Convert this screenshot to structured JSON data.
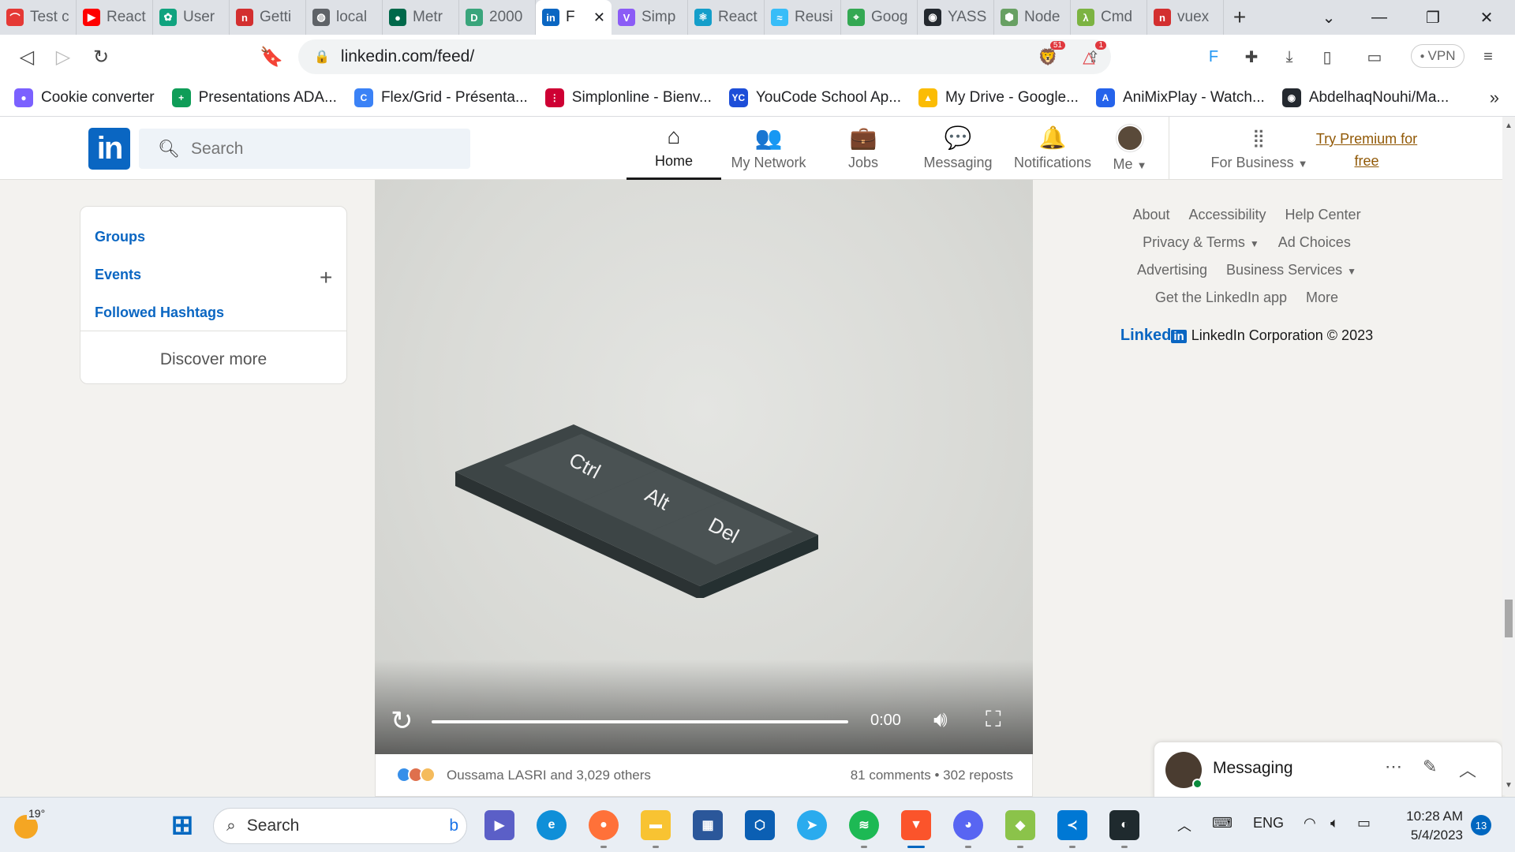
{
  "browser": {
    "tabs": [
      {
        "title": "Test c",
        "color": "#e53935",
        "glyph": "⌒"
      },
      {
        "title": "React",
        "color": "#ff0000",
        "glyph": "▶"
      },
      {
        "title": "User",
        "color": "#10a37f",
        "glyph": "✿"
      },
      {
        "title": "Getti",
        "color": "#d32f2f",
        "glyph": "n"
      },
      {
        "title": "local",
        "color": "#5f6368",
        "glyph": "◍"
      },
      {
        "title": "Metr",
        "color": "#00684a",
        "glyph": "●"
      },
      {
        "title": "2000",
        "color": "#3aa57c",
        "glyph": "D"
      },
      {
        "title": "F",
        "color": "#0a66c2",
        "glyph": "in"
      },
      {
        "title": "Simp",
        "color": "#8b5cf6",
        "glyph": "V"
      },
      {
        "title": "React",
        "color": "#149eca",
        "glyph": "⚛"
      },
      {
        "title": "Reusi",
        "color": "#38bdf8",
        "glyph": "≈"
      },
      {
        "title": "Goog",
        "color": "#34a853",
        "glyph": "⌖"
      },
      {
        "title": "YASS",
        "color": "#24292f",
        "glyph": "◉"
      },
      {
        "title": "Node",
        "color": "#68a063",
        "glyph": "⬢"
      },
      {
        "title": "Cmd",
        "color": "#7cb342",
        "glyph": "λ"
      },
      {
        "title": "vuex",
        "color": "#d32f2f",
        "glyph": "n"
      }
    ],
    "url": "linkedin.com/feed/",
    "brave_badge": "51",
    "alert_badge": "1",
    "vpn_label": "VPN",
    "bookmarks": [
      {
        "label": "Cookie converter",
        "color": "#7b61ff",
        "glyph": "●"
      },
      {
        "label": "Presentations ADA...",
        "color": "#0f9d58",
        "glyph": "+"
      },
      {
        "label": "Flex/Grid - Présenta...",
        "color": "#3b82f6",
        "glyph": "C"
      },
      {
        "label": "Simplonline - Bienv...",
        "color": "#ce0033",
        "glyph": "⋮"
      },
      {
        "label": "YouCode School Ap...",
        "color": "#1d4ed8",
        "glyph": "YC"
      },
      {
        "label": "My Drive - Google...",
        "color": "#fbbc04",
        "glyph": "▲"
      },
      {
        "label": "AniMixPlay - Watch...",
        "color": "#2563eb",
        "glyph": "A"
      },
      {
        "label": "AbdelhaqNouhi/Ma...",
        "color": "#24292f",
        "glyph": "◉"
      }
    ]
  },
  "linkedin": {
    "logo": "in",
    "search_placeholder": "Search",
    "nav": [
      {
        "label": "Home",
        "icon": "home-icon",
        "glyph": "⌂"
      },
      {
        "label": "My Network",
        "icon": "network-icon",
        "glyph": "👥"
      },
      {
        "label": "Jobs",
        "icon": "briefcase-icon",
        "glyph": "💼"
      },
      {
        "label": "Messaging",
        "icon": "chat-icon",
        "glyph": "💬"
      },
      {
        "label": "Notifications",
        "icon": "bell-icon",
        "glyph": "🔔"
      }
    ],
    "me_label": "Me",
    "for_business_label": "For Business",
    "premium_line1": "Try Premium for",
    "premium_line2": "free",
    "sidebar": {
      "groups": "Groups",
      "events": "Events",
      "hashtags": "Followed Hashtags",
      "discover": "Discover more"
    },
    "video": {
      "key_labels": [
        "Ctrl",
        "Alt",
        "Del"
      ],
      "time": "0:00",
      "progress": 0
    },
    "post_stats": {
      "reactions": "Oussama LASRI and 3,029 others",
      "comments_reposts": "81 comments • 302 reposts"
    },
    "footer": {
      "row1": [
        "About",
        "Accessibility",
        "Help Center"
      ],
      "row2": [
        "Privacy & Terms",
        "Ad Choices"
      ],
      "row3": [
        "Advertising",
        "Business Services"
      ],
      "row4": [
        "Get the LinkedIn app",
        "More"
      ],
      "brand": "Linked",
      "brand_in": "in",
      "copyright": "LinkedIn Corporation © 2023"
    },
    "messaging_title": "Messaging"
  },
  "taskbar": {
    "temperature": "19°",
    "search_placeholder": "Search",
    "language": "ENG",
    "time": "10:28 AM",
    "date": "5/4/2023",
    "notifications": "13"
  }
}
